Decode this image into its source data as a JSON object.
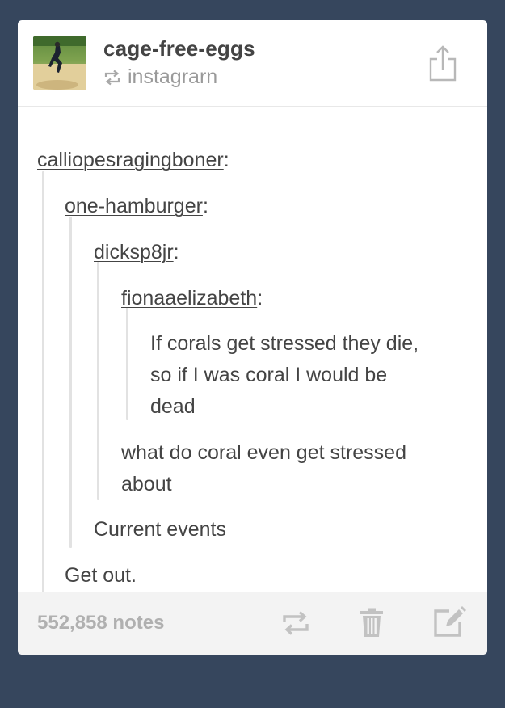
{
  "post": {
    "blog_name": "cage-free-eggs",
    "reblogged_from": "instagrarn",
    "thread": [
      {
        "username": "calliopesragingboner",
        "sep": ":"
      },
      {
        "username": "one-hamburger",
        "sep": ":"
      },
      {
        "username": "dicksp8jr",
        "sep": ":"
      },
      {
        "username": "fionaaelizabeth",
        "sep": ":"
      }
    ],
    "quote_lines": [
      "If corals get stressed they die,",
      "so if I was coral I would be",
      "dead"
    ],
    "reply_3_lines": [
      "what do coral even get stressed",
      "about"
    ],
    "reply_2": "Current events",
    "reply_1": "Get out.",
    "notes": "552,858 notes"
  },
  "icons": {
    "share": "share-icon",
    "reblog": "reblog-icon",
    "delete": "trash-icon",
    "edit": "edit-icon",
    "avatar": "avatar-image"
  },
  "colors": {
    "background": "#36465d",
    "card": "#ffffff",
    "footer": "#f3f3f3",
    "text": "#444444",
    "muted": "#9a9a9a",
    "quote_bar": "#e2e2e2",
    "icon": "#c2c2c2"
  }
}
